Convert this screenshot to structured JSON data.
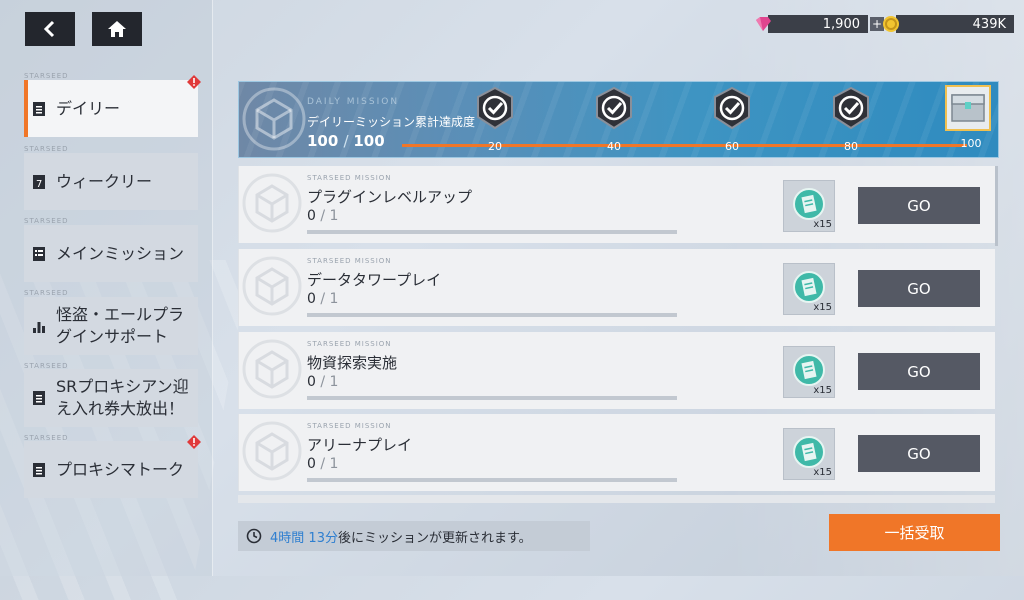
{
  "nav": {
    "back_icon": "chevron-left-icon",
    "home_icon": "home-icon"
  },
  "currencies": {
    "gems": {
      "value": "1,900",
      "icon": "gem-icon",
      "plus": "+"
    },
    "coins": {
      "value": "439K",
      "icon": "coin-icon"
    }
  },
  "sidebar": {
    "items": [
      {
        "tag": "STARSEED",
        "label": "デイリー",
        "active": true,
        "alert": true
      },
      {
        "tag": "STARSEED",
        "label": "ウィークリー",
        "active": false,
        "alert": false
      },
      {
        "tag": "STARSEED",
        "label": "メインミッション",
        "active": false,
        "alert": false
      },
      {
        "tag": "STARSEED",
        "label": "怪盗・エールプラグインサポート",
        "active": false,
        "alert": false
      },
      {
        "tag": "STARSEED",
        "label": "SRプロキシアン迎え入れ券大放出！",
        "active": false,
        "alert": false
      },
      {
        "tag": "STARSEED",
        "label": "プロキシマトーク",
        "active": false,
        "alert": true
      }
    ]
  },
  "banner": {
    "label": "DAILY MISSION",
    "title": "デイリーミッション累計達成度",
    "current": "100",
    "total": "100",
    "milestones": [
      "20",
      "40",
      "60",
      "80"
    ],
    "final": "100"
  },
  "missions": [
    {
      "tag": "STARSEED MISSION",
      "name": "プラグインレベルアップ",
      "current": "0",
      "total": "1",
      "reward_qty": "x15",
      "button": "GO"
    },
    {
      "tag": "STARSEED MISSION",
      "name": "データタワープレイ",
      "current": "0",
      "total": "1",
      "reward_qty": "x15",
      "button": "GO"
    },
    {
      "tag": "STARSEED MISSION",
      "name": "物資探索実施",
      "current": "0",
      "total": "1",
      "reward_qty": "x15",
      "button": "GO"
    },
    {
      "tag": "STARSEED MISSION",
      "name": "アリーナプレイ",
      "current": "0",
      "total": "1",
      "reward_qty": "x15",
      "button": "GO"
    }
  ],
  "footer": {
    "hours": "4時間",
    "minutes": "13分",
    "suffix": "後にミッションが更新されます。",
    "claim_all": "一括受取"
  },
  "colors": {
    "accent": "#f07628",
    "button_dark": "#555964",
    "highlight_blue": "#2f7fd0"
  }
}
